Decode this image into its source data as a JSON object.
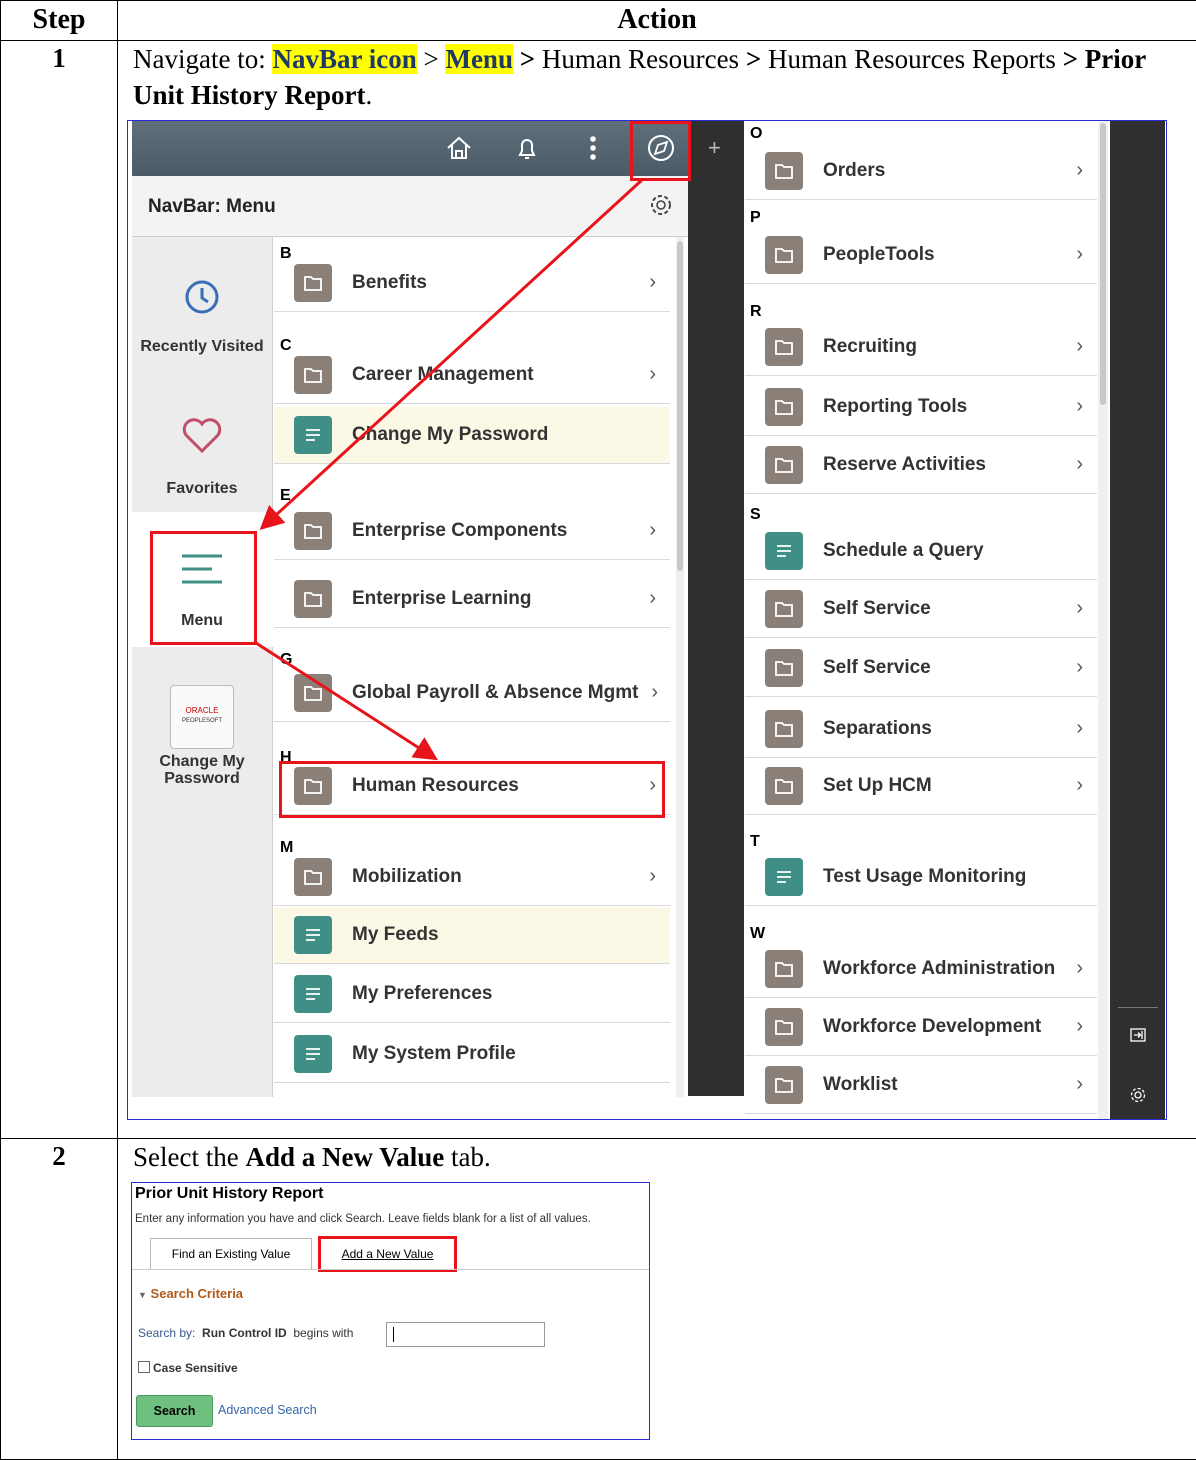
{
  "table": {
    "header_step": "Step",
    "header_action": "Action"
  },
  "step1": {
    "number": "1",
    "text_prefix": "Navigate to: ",
    "navbar_icon": "NavBar icon",
    "sep1": " > ",
    "menu": "Menu",
    "sep2": " > ",
    "hr": "Human Resources",
    "sep3": " > ",
    "hr2": "Human Resources Reports",
    "sep4": " > ",
    "report": "Prior Unit History Report",
    "end": "."
  },
  "navbar": {
    "title": "NavBar: Menu",
    "sidebar": [
      {
        "label": "Recently Visited",
        "icon": "clock-icon"
      },
      {
        "label": "Favorites",
        "icon": "heart-icon"
      },
      {
        "label": "Menu",
        "icon": "menu-icon"
      },
      {
        "label": "Change My Password",
        "icon": "oracle-peoplesoft-tile",
        "tile_line1": "ORACLE",
        "tile_line2": "PEOPLESOFT"
      }
    ],
    "left_list": [
      {
        "letter": "B",
        "items": [
          {
            "label": "Benefits",
            "type": "folder"
          }
        ]
      },
      {
        "letter": "C",
        "items": [
          {
            "label": "Career Management",
            "type": "folder"
          },
          {
            "label": "Change My Password",
            "type": "doc"
          }
        ]
      },
      {
        "letter": "E",
        "items": [
          {
            "label": "Enterprise Components",
            "type": "folder"
          },
          {
            "label": "Enterprise Learning",
            "type": "folder"
          }
        ]
      },
      {
        "letter": "G",
        "items": [
          {
            "label": "Global Payroll & Absence Mgmt",
            "type": "folder"
          }
        ]
      },
      {
        "letter": "H",
        "items": [
          {
            "label": "Human Resources",
            "type": "folder"
          }
        ]
      },
      {
        "letter": "M",
        "items": [
          {
            "label": "Mobilization",
            "type": "folder"
          },
          {
            "label": "My Feeds",
            "type": "doc"
          },
          {
            "label": "My Preferences",
            "type": "doc"
          },
          {
            "label": "My System Profile",
            "type": "doc"
          }
        ]
      }
    ],
    "right_list": [
      {
        "letter": "O",
        "items": [
          {
            "label": "Orders",
            "type": "folder"
          }
        ]
      },
      {
        "letter": "P",
        "items": [
          {
            "label": "PeopleTools",
            "type": "folder"
          }
        ]
      },
      {
        "letter": "R",
        "items": [
          {
            "label": "Recruiting",
            "type": "folder"
          },
          {
            "label": "Reporting Tools",
            "type": "folder"
          },
          {
            "label": "Reserve Activities",
            "type": "folder"
          }
        ]
      },
      {
        "letter": "S",
        "items": [
          {
            "label": "Schedule a Query",
            "type": "doc"
          },
          {
            "label": "Self Service",
            "type": "folder"
          },
          {
            "label": "Self Service",
            "type": "folder"
          },
          {
            "label": "Separations",
            "type": "folder"
          },
          {
            "label": "Set Up HCM",
            "type": "folder"
          }
        ]
      },
      {
        "letter": "T",
        "items": [
          {
            "label": "Test Usage Monitoring",
            "type": "doc"
          }
        ]
      },
      {
        "letter": "W",
        "items": [
          {
            "label": "Workforce Administration",
            "type": "folder"
          },
          {
            "label": "Workforce Development",
            "type": "folder"
          },
          {
            "label": "Worklist",
            "type": "folder"
          }
        ]
      }
    ],
    "highlight_color": "#e8141c"
  },
  "step2": {
    "number": "2",
    "text_prefix": "Select the ",
    "bold": "Add a New Value",
    "text_suffix": " tab."
  },
  "search_page": {
    "title": "Prior Unit History Report",
    "instructions": "Enter any information you have and click Search. Leave fields blank for a list of all values.",
    "tabs": [
      "Find an Existing Value",
      "Add a New Value"
    ],
    "criteria": "Search Criteria",
    "search_by_label": "Search by:",
    "search_field": "Run Control ID",
    "operator": "begins with",
    "case_sensitive": "Case Sensitive",
    "search_button": "Search",
    "advanced_search": "Advanced Search"
  }
}
